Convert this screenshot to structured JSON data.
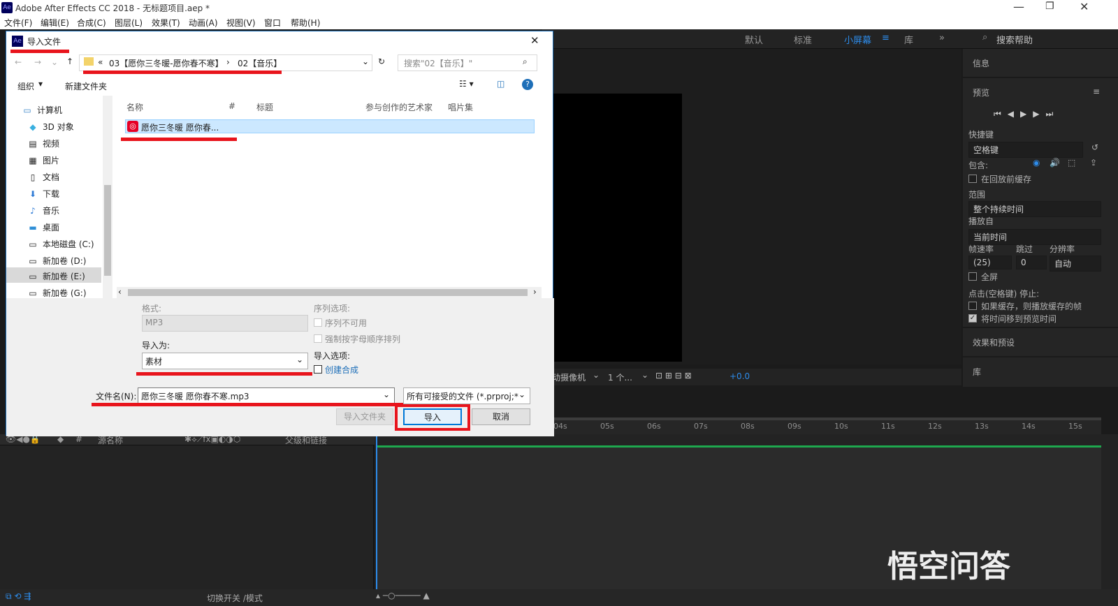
{
  "window": {
    "title": "Adobe After Effects CC 2018 - 无标题项目.aep *",
    "app_badge": "Ae"
  },
  "menu": [
    "文件(F)",
    "编辑(E)",
    "合成(C)",
    "图层(L)",
    "效果(T)",
    "动画(A)",
    "视图(V)",
    "窗口",
    "帮助(H)"
  ],
  "workspaces": {
    "default": "默认",
    "standard": "标准",
    "small": "小屏幕",
    "library": "库",
    "search_placeholder": "搜索帮助"
  },
  "right_panel": {
    "info": "信息",
    "preview": "预览",
    "shortcut_label": "快捷键",
    "shortcut_value": "空格键",
    "include_label": "包含:",
    "cache_before": "在回放前缓存",
    "range_label": "范围",
    "range_value": "整个持续时间",
    "play_from_label": "播放自",
    "play_from_value": "当前时间",
    "fps_label": "帧速率",
    "skip_label": "跳过",
    "resolution_label": "分辨率",
    "fps_value": "(25)",
    "skip_value": "0",
    "resolution_value": "自动",
    "fullscreen": "全屏",
    "stop_label": "点击(空格键) 停止:",
    "if_cached": "如果缓存，则播放缓存的帧",
    "move_time": "将时间移到预览时间",
    "effects": "效果和预设",
    "library": "库"
  },
  "comp_bar": {
    "camera": "活动摄像机",
    "views": "1 个...",
    "offset": "+0.0"
  },
  "timeline": {
    "col_source": "源名称",
    "col_parent": "父级和链接",
    "switch_mode": "切换开关 /模式",
    "ruler": [
      "04s",
      "05s",
      "06s",
      "07s",
      "08s",
      "09s",
      "10s",
      "11s",
      "12s",
      "13s",
      "14s",
      "15s"
    ]
  },
  "dialog": {
    "title": "导入文件",
    "breadcrumb_1": "03【愿你三冬暖-愿你春不寒】",
    "breadcrumb_2": "02【音乐】",
    "search_placeholder": "搜索\"02【音乐】\"",
    "organize": "组织",
    "new_folder": "新建文件夹",
    "nav": [
      "计算机",
      "3D 对象",
      "视频",
      "图片",
      "文档",
      "下载",
      "音乐",
      "桌面",
      "本地磁盘 (C:)",
      "新加卷 (D:)",
      "新加卷 (E:)",
      "新加卷 (G:)"
    ],
    "columns": [
      "名称",
      "#",
      "标题",
      "参与创作的艺术家",
      "唱片集"
    ],
    "file": "愿你三冬暖 愿你春...",
    "format_label": "格式:",
    "format_value": "MP3",
    "seq_label": "序列选项:",
    "seq_unavailable": "序列不可用",
    "force_alpha": "强制按字母顺序排列",
    "import_as_label": "导入为:",
    "import_as_value": "素材",
    "import_opts_label": "导入选项:",
    "create_comp": "创建合成",
    "filename_label": "文件名(N):",
    "filename_value": "愿你三冬暖 愿你春不寒.mp3",
    "filetype": "所有可接受的文件 (*.prproj;*.c",
    "import_folder": "导入文件夹",
    "import": "导入",
    "cancel": "取消"
  },
  "watermark": "悟空问答",
  "colors": {
    "highlight": "#e8141c",
    "accent": "#1e6fb8",
    "ae_blue": "#2d8ceb"
  }
}
